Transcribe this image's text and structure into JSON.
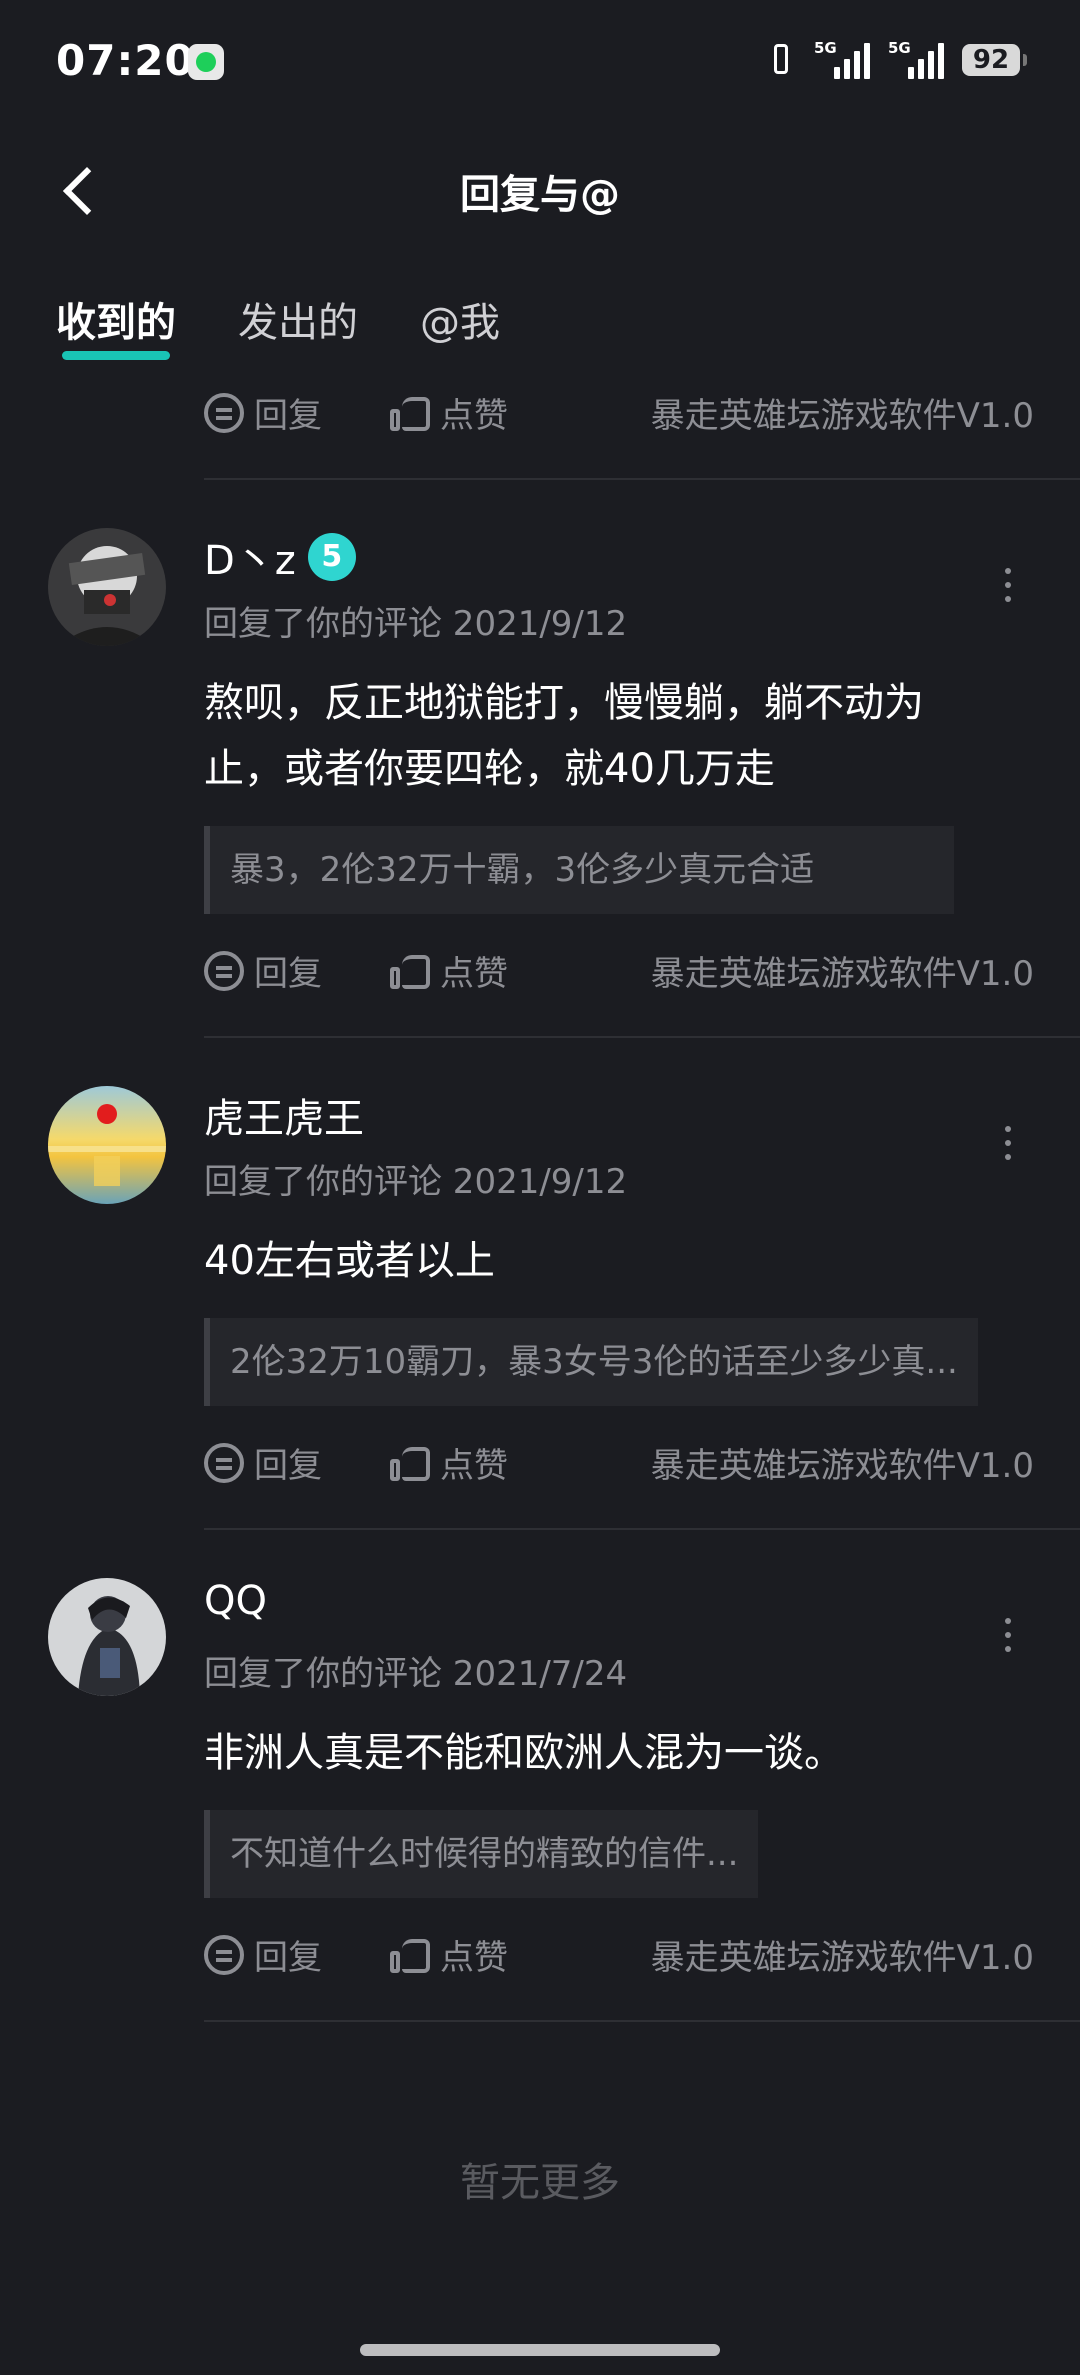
{
  "status_bar": {
    "time": "07:20",
    "signal1_label": "5G",
    "signal2_label": "5G",
    "battery": "92"
  },
  "header": {
    "title": "回复与@"
  },
  "tabs": [
    {
      "label": "收到的",
      "active": true
    },
    {
      "label": "发出的",
      "active": false
    },
    {
      "label": "@我",
      "active": false
    }
  ],
  "top_actions": {
    "reply_label": "回复",
    "like_label": "点赞",
    "source": "暴走英雄坛游戏软件V1.0"
  },
  "items": [
    {
      "username": "D丶z",
      "level_badge": "5",
      "meta": "回复了你的评论 2021/9/12",
      "content": "熬呗，反正地狱能打，慢慢躺，躺不动为止，或者你要四轮，就40几万走",
      "quote": "暴3，2伦32万十霸，3伦多少真元合适",
      "reply_label": "回复",
      "like_label": "点赞",
      "source": "暴走英雄坛游戏软件V1.0"
    },
    {
      "username": "虎王虎王",
      "meta": "回复了你的评论 2021/9/12",
      "content": "40左右或者以上",
      "quote": "2伦32万10霸刀，暴3女号3伦的话至少多少真...",
      "reply_label": "回复",
      "like_label": "点赞",
      "source": "暴走英雄坛游戏软件V1.0"
    },
    {
      "username": "QQ",
      "meta": "回复了你的评论 2021/7/24",
      "content": "非洲人真是不能和欧洲人混为一谈。",
      "quote": "不知道什么时候得的精致的信件...",
      "reply_label": "回复",
      "like_label": "点赞",
      "source": "暴走英雄坛游戏软件V1.0"
    }
  ],
  "footer": "暂无更多"
}
